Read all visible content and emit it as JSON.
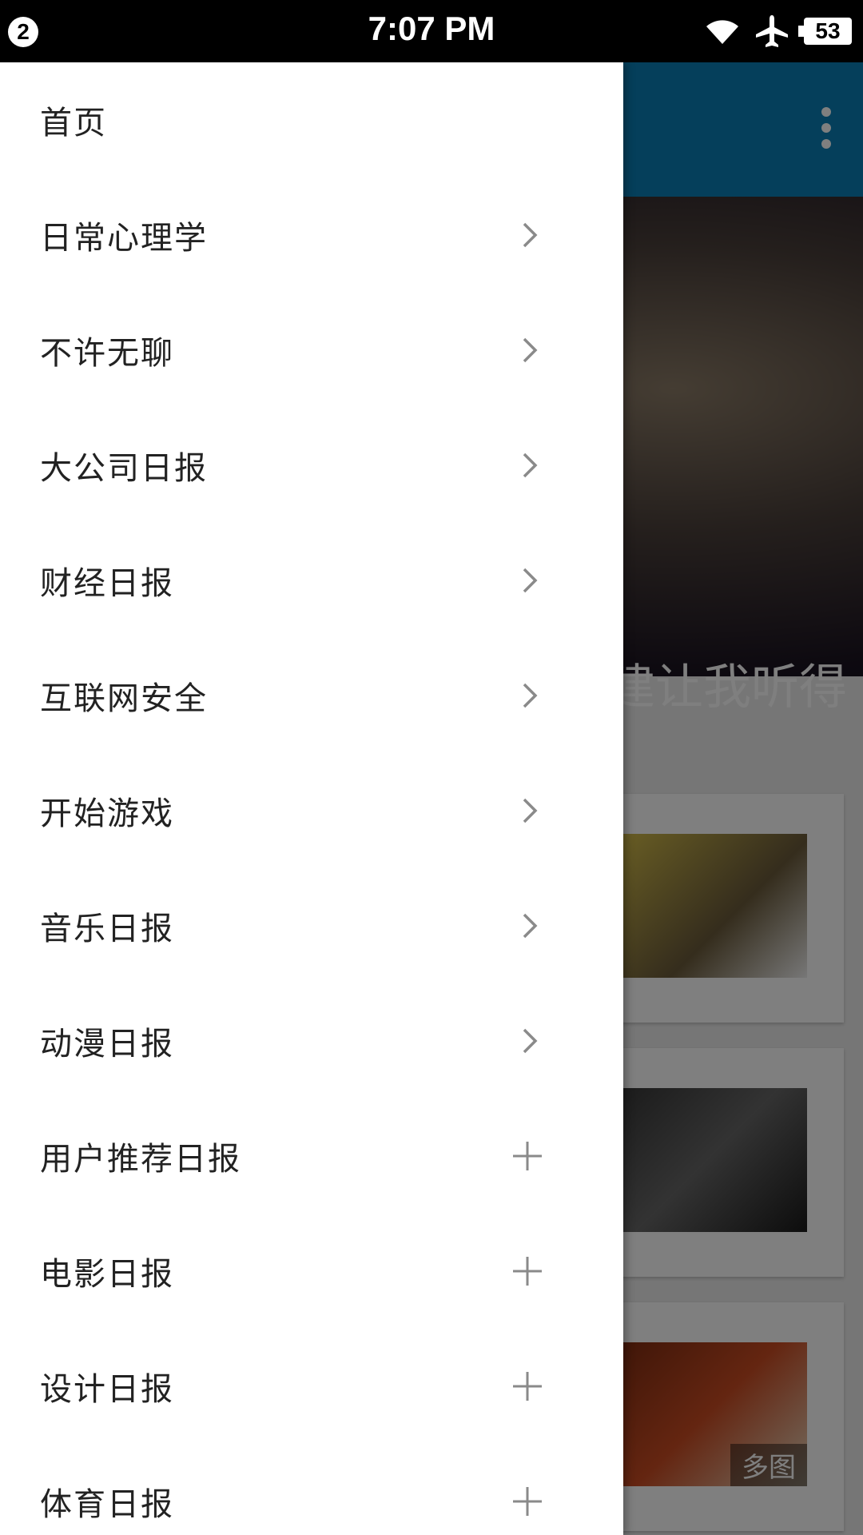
{
  "status_bar": {
    "notification_count": "2",
    "time": "7:07 PM",
    "battery": "53",
    "icons": [
      "wifi-icon",
      "airplane-mode-icon",
      "battery-icon"
    ]
  },
  "background_app": {
    "hero_caption": "建让我听得",
    "card_badge": "多图",
    "toolbar_color": "#0a7fb6"
  },
  "drawer": {
    "items": [
      {
        "label": "首页",
        "action": "none"
      },
      {
        "label": "日常心理学",
        "action": "chevron"
      },
      {
        "label": "不许无聊",
        "action": "chevron"
      },
      {
        "label": "大公司日报",
        "action": "chevron"
      },
      {
        "label": "财经日报",
        "action": "chevron"
      },
      {
        "label": "互联网安全",
        "action": "chevron"
      },
      {
        "label": "开始游戏",
        "action": "chevron"
      },
      {
        "label": "音乐日报",
        "action": "chevron"
      },
      {
        "label": "动漫日报",
        "action": "chevron"
      },
      {
        "label": "用户推荐日报",
        "action": "plus"
      },
      {
        "label": "电影日报",
        "action": "plus"
      },
      {
        "label": "设计日报",
        "action": "plus"
      },
      {
        "label": "体育日报",
        "action": "plus"
      }
    ]
  }
}
